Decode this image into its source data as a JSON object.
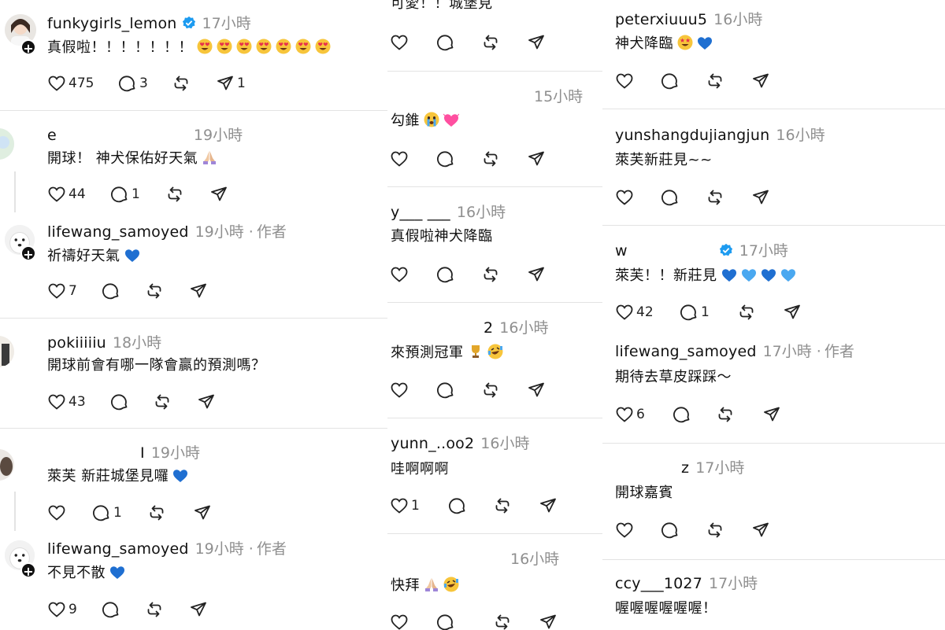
{
  "colors": {
    "text": "#111111",
    "muted": "#8f8f8f",
    "divider": "#e3e3e3",
    "verified": "#1d9bf0",
    "heart_blue": "#1f6fd1",
    "heart_light": "#4aa8f0"
  },
  "col1": {
    "posts": [
      {
        "user": "funkygirls_lemon",
        "time": "17小時",
        "verified": true,
        "text": "真假啦！！！！！！！",
        "emojis": [
          "heart-eyes",
          "heart-eyes",
          "heart-eyes",
          "heart-eyes",
          "heart-eyes",
          "heart-eyes",
          "heart-eyes"
        ],
        "likes": "475",
        "comments": "3",
        "shares": "1"
      },
      {
        "user": "e",
        "time": "19小時",
        "text": "開球！ 神犬保佑好天氣",
        "emojis": [
          "pray"
        ],
        "likes": "44",
        "comments": "1"
      },
      {
        "user": "lifewang_samoyed",
        "time": "19小時",
        "author": "作者",
        "text": "祈禱好天氣",
        "emojis": [
          "blue-heart"
        ],
        "likes": "7"
      },
      {
        "user": "pokiiiiiu",
        "time": "18小時",
        "text": "開球前會有哪一隊會贏的預測嗎？",
        "likes": "43"
      },
      {
        "user": "I",
        "time": "19小時",
        "text": "萊芙 新莊城堡見囉",
        "emojis": [
          "blue-heart"
        ],
        "comments": "1"
      },
      {
        "user": "lifewang_samoyed",
        "time": "19小時",
        "author": "作者",
        "text": "不見不散",
        "emojis": [
          "blue-heart"
        ],
        "likes": "9"
      }
    ]
  },
  "col2": {
    "posts": [
      {
        "user": "",
        "time": "",
        "text": "可愛！！城堡見"
      },
      {
        "user": "",
        "time": "15小時",
        "text": "勾錐",
        "emojis": [
          "crying",
          "pink-heart"
        ]
      },
      {
        "user": "y___ ___",
        "time": "16小時",
        "text": "真假啦神犬降臨"
      },
      {
        "user": "2",
        "time": "16小時",
        "text": "來預測冠軍",
        "emojis": [
          "trophy",
          "rofl"
        ]
      },
      {
        "user": "yunn_..oo2",
        "time": "16小時",
        "text": "哇啊啊啊",
        "likes": "1"
      },
      {
        "user": "",
        "time": "16小時",
        "text": "快拜",
        "emojis": [
          "pray",
          "rofl"
        ]
      }
    ]
  },
  "col3": {
    "posts": [
      {
        "user": "peterxiuuu5",
        "time": "16小時",
        "text": "神犬降臨",
        "emojis": [
          "star-struck",
          "blue-heart"
        ]
      },
      {
        "user": "yunshangdujiangjun",
        "time": "16小時",
        "text": "萊芙新莊見~~"
      },
      {
        "user": "w",
        "time": "17小時",
        "verified": true,
        "text": "萊芙！！新莊見",
        "emojis": [
          "blue-heart",
          "light-blue-heart",
          "blue-heart",
          "light-blue-heart"
        ],
        "likes": "42",
        "comments": "1"
      },
      {
        "user": "lifewang_samoyed",
        "time": "17小時",
        "author": "作者",
        "text": "期待去草皮踩踩～",
        "likes": "6"
      },
      {
        "user": "z",
        "time": "17小時",
        "text": "開球嘉賓"
      },
      {
        "user": "ccy___1027",
        "time": "17小時",
        "text": "喔喔喔喔喔喔！"
      }
    ]
  },
  "icons": {
    "like": "heart-outline-icon",
    "comment": "comment-bubble-icon",
    "repost": "repost-arrows-icon",
    "share": "send-plane-icon",
    "verified": "verified-badge-icon"
  }
}
